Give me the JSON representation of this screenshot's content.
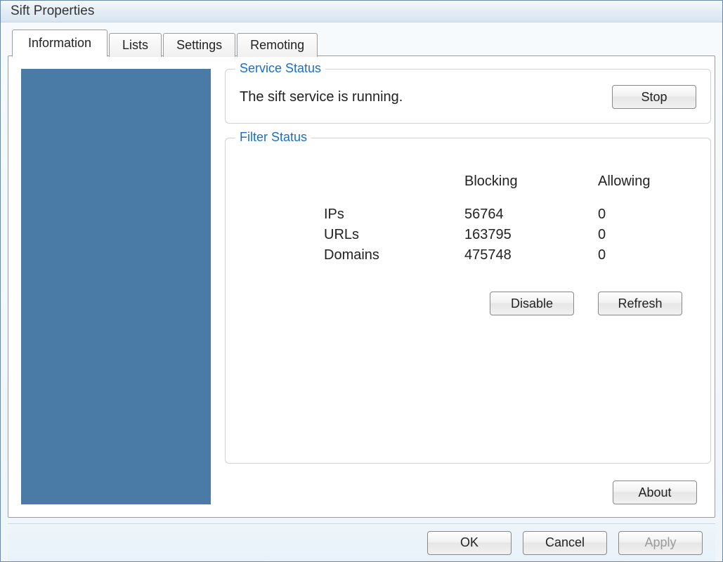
{
  "window": {
    "title": "Sift Properties"
  },
  "tabs": {
    "information": "Information",
    "lists": "Lists",
    "settings": "Settings",
    "remoting": "Remoting"
  },
  "service_status": {
    "title": "Service Status",
    "message": "The sift service is running.",
    "stop_label": "Stop"
  },
  "filter_status": {
    "title": "Filter Status",
    "headers": {
      "blocking": "Blocking",
      "allowing": "Allowing"
    },
    "rows": {
      "ips": {
        "label": "IPs",
        "blocking": "56764",
        "allowing": "0"
      },
      "urls": {
        "label": "URLs",
        "blocking": "163795",
        "allowing": "0"
      },
      "domains": {
        "label": "Domains",
        "blocking": "475748",
        "allowing": "0"
      }
    },
    "disable_label": "Disable",
    "refresh_label": "Refresh"
  },
  "about_label": "About",
  "footer": {
    "ok": "OK",
    "cancel": "Cancel",
    "apply": "Apply"
  }
}
